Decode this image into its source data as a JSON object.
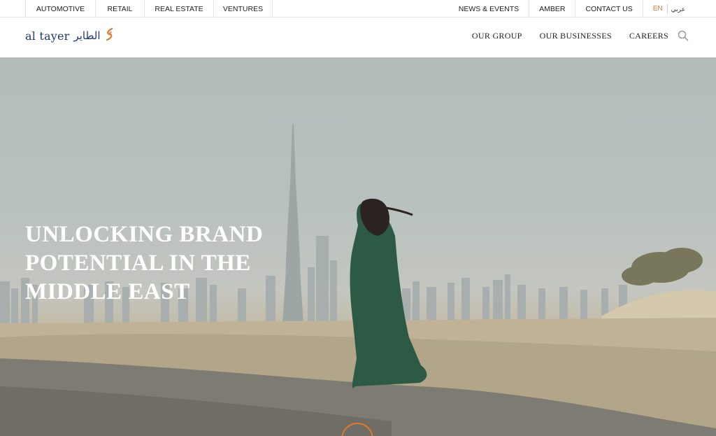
{
  "topbar": {
    "left": [
      "AUTOMOTIVE",
      "RETAIL",
      "REAL ESTATE",
      "VENTURES"
    ],
    "right": [
      "NEWS & EVENTS",
      "AMBER",
      "CONTACT US"
    ],
    "lang_en": "EN",
    "lang_ar": "عربي"
  },
  "header": {
    "logo_en": "al tayer",
    "logo_ar": "الطاير",
    "nav": [
      "OUR GROUP",
      "OUR BUSINESSES",
      "CAREERS"
    ],
    "search_icon": "search-icon"
  },
  "hero": {
    "title": "UNLOCKING BRAND POTENTIAL IN THE MIDDLE EAST"
  },
  "colors": {
    "accent": "#e07a2e",
    "brand": "#1f3a6e"
  }
}
